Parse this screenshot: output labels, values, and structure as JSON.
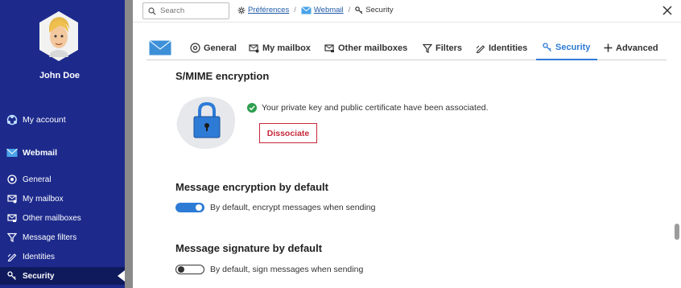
{
  "user": {
    "name": "John Doe"
  },
  "sidebar": {
    "items": [
      {
        "label": "My account",
        "icon": "account-icon"
      },
      {
        "label": "Webmail",
        "icon": "mail-icon"
      },
      {
        "label": "General",
        "icon": "general-icon"
      },
      {
        "label": "My mailbox",
        "icon": "mailbox-icon"
      },
      {
        "label": "Other mailboxes",
        "icon": "other-mailboxes-icon"
      },
      {
        "label": "Message filters",
        "icon": "filter-icon"
      },
      {
        "label": "Identities",
        "icon": "pen-icon"
      },
      {
        "label": "Security",
        "icon": "key-icon"
      }
    ],
    "active_index": 7
  },
  "topbar": {
    "search_placeholder": "Search",
    "breadcrumb": [
      "Préférences",
      "Webmail",
      "Security"
    ]
  },
  "tabs": [
    {
      "label": "General",
      "icon": "general-icon"
    },
    {
      "label": "My mailbox",
      "icon": "mailbox-icon"
    },
    {
      "label": "Other mailboxes",
      "icon": "other-mailboxes-icon"
    },
    {
      "label": "Filters",
      "icon": "filter-icon"
    },
    {
      "label": "Identities",
      "icon": "pen-icon"
    },
    {
      "label": "Security",
      "icon": "key-icon"
    },
    {
      "label": "Advanced",
      "icon": "plus-icon"
    }
  ],
  "active_tab_index": 5,
  "smime": {
    "title": "S/MIME encryption",
    "status": "Your private key and public certificate have been associated.",
    "dissociate_label": "Dissociate"
  },
  "encryption": {
    "title": "Message encryption by default",
    "toggle_label": "By default, encrypt messages when sending",
    "enabled": true
  },
  "signature": {
    "title": "Message signature by default",
    "toggle_label": "By default, sign messages when sending",
    "enabled": false
  },
  "colors": {
    "sidebar": "#1d2a8c",
    "accent": "#2e7bd6",
    "danger": "#c6283a",
    "success": "#2e9e4f"
  }
}
